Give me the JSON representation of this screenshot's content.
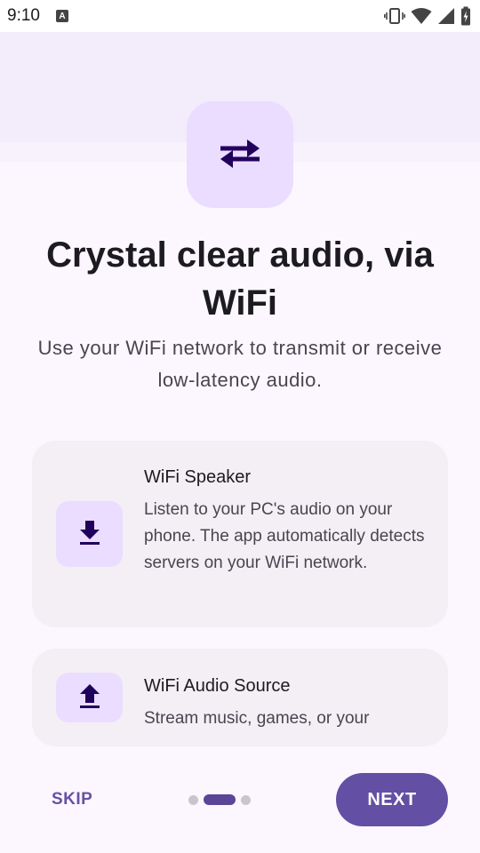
{
  "status_bar": {
    "time": "9:10",
    "notification_icon": "text-a-icon",
    "icons": [
      "vibrate-icon",
      "wifi-icon",
      "signal-icon",
      "battery-charging-icon"
    ]
  },
  "hero": {
    "icon": "swap-arrows-icon",
    "title": "Crystal clear audio, via WiFi",
    "subtitle": "Use your WiFi network to transmit or receive low-latency audio."
  },
  "cards": [
    {
      "icon": "download-icon",
      "title": "WiFi Speaker",
      "description": "Listen to your PC's audio on your phone. The app automatically detects servers on your WiFi network."
    },
    {
      "icon": "upload-icon",
      "title": "WiFi Audio Source",
      "description": "Stream music, games, or your"
    }
  ],
  "navigation": {
    "skip_label": "SKIP",
    "next_label": "NEXT",
    "page_count": 3,
    "current_page": 2
  },
  "colors": {
    "primary": "#634fa3",
    "primary_container": "#eaddff",
    "background": "#fcf7fe",
    "card": "#f3eff5"
  }
}
